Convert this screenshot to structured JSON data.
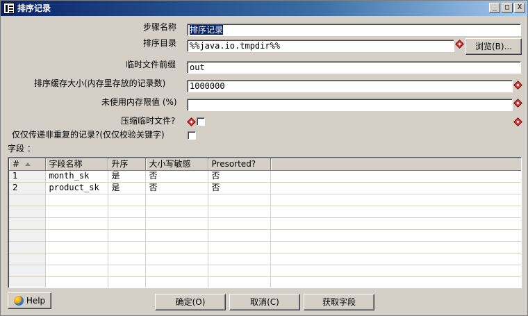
{
  "window": {
    "title": "排序记录",
    "controls": {
      "minimize": "_",
      "maximize": "□",
      "close": "X"
    }
  },
  "form": {
    "step_name": {
      "label": "步骤名称",
      "value": "排序记录"
    },
    "sort_dir": {
      "label": "排序目录",
      "value": "%%java.io.tmpdir%%",
      "browse_label": "浏览(B)..."
    },
    "temp_prefix": {
      "label": "临时文件前缀",
      "value": "out"
    },
    "sort_size": {
      "label": "排序缓存大小(内存里存放的记录数)",
      "value": "1000000"
    },
    "free_memory": {
      "label": "未使用内存限值 (%)",
      "value": ""
    },
    "compress": {
      "label": "压缩临时文件?",
      "checked": false
    },
    "unique_rows": {
      "label": "仅仅传递非重复的记录?(仅仅校验关键字)",
      "checked": false
    }
  },
  "fields_section": {
    "label": "字段 ：",
    "columns": [
      "#",
      "字段名称",
      "升序",
      "大小写敏感",
      "Presorted?"
    ],
    "rows": [
      [
        "1",
        "month_sk",
        "是",
        "否",
        "否"
      ],
      [
        "2",
        "product_sk",
        "是",
        "否",
        "否"
      ]
    ]
  },
  "buttons": {
    "help": "Help",
    "ok": "确定(O)",
    "cancel": "取消(C)",
    "get_fields": "获取字段"
  },
  "colors": {
    "titlebar": "#0a246a",
    "dialog_bg": "#d4d0c8",
    "required_marker": "#d04040"
  },
  "icons": {
    "title": "table-icon",
    "required": "diamond-warning-icon",
    "help": "globe-icon",
    "sort": "sort-up-icon"
  }
}
